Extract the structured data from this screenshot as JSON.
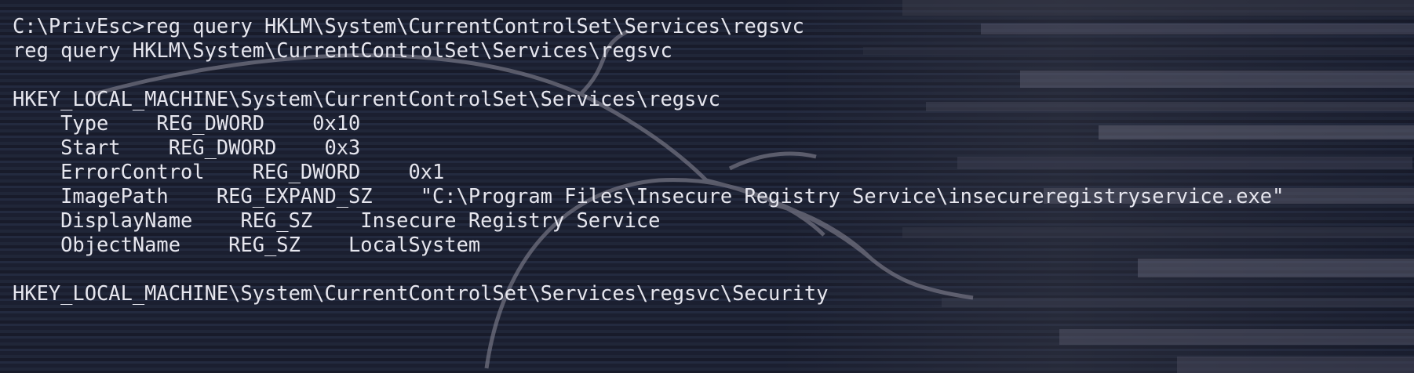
{
  "terminal": {
    "lines": [
      "C:\\PrivEsc>reg query HKLM\\System\\CurrentControlSet\\Services\\regsvc",
      "reg query HKLM\\System\\CurrentControlSet\\Services\\regsvc",
      "",
      "HKEY_LOCAL_MACHINE\\System\\CurrentControlSet\\Services\\regsvc",
      "    Type    REG_DWORD    0x10",
      "    Start    REG_DWORD    0x3",
      "    ErrorControl    REG_DWORD    0x1",
      "    ImagePath    REG_EXPAND_SZ    \"C:\\Program Files\\Insecure Registry Service\\insecureregistryservice.exe\"",
      "    DisplayName    REG_SZ    Insecure Registry Service",
      "    ObjectName    REG_SZ    LocalSystem",
      "",
      "HKEY_LOCAL_MACHINE\\System\\CurrentControlSet\\Services\\regsvc\\Security"
    ]
  },
  "colors": {
    "text": "#e6e6ee",
    "background": "#1a1d2b"
  },
  "background_icon": "kali-dragon-wallpaper"
}
